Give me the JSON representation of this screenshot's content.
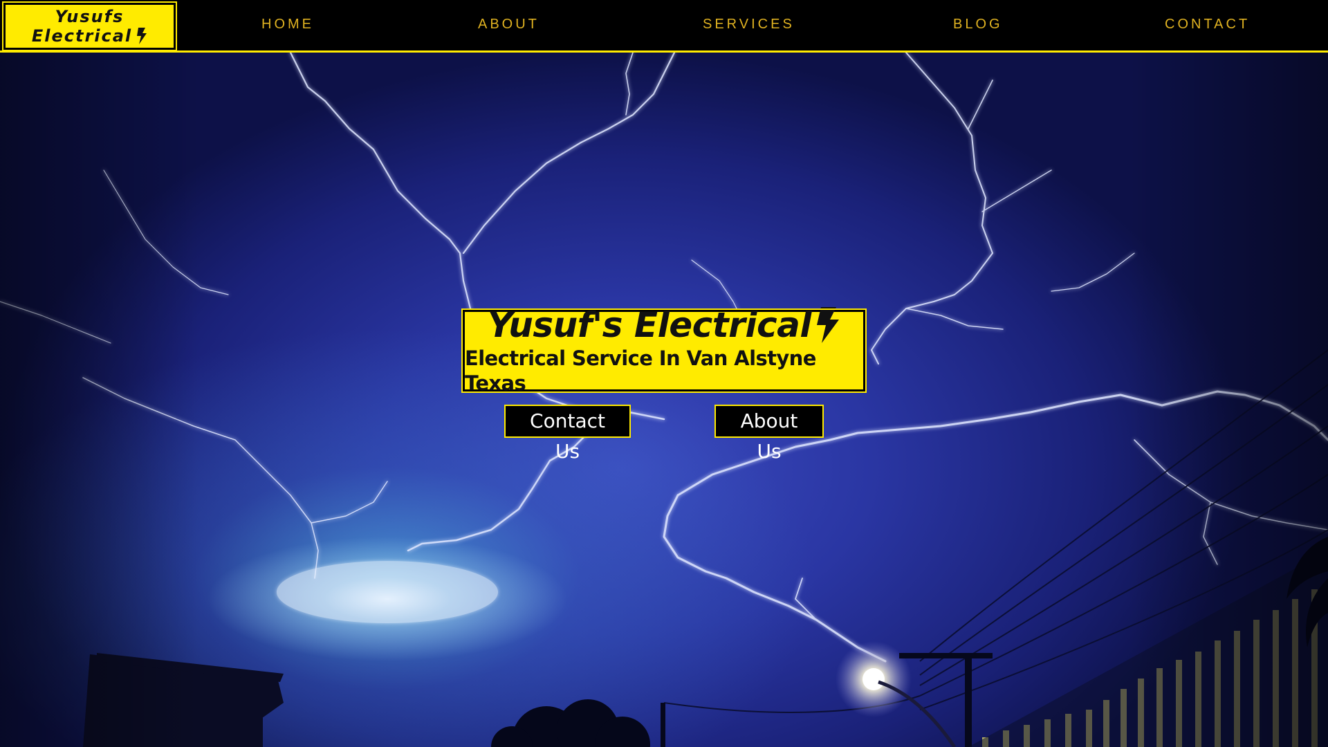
{
  "brand": {
    "line1": "Yusufs",
    "line2": "Electrical",
    "icon": "lightning-bolt-icon",
    "color": "#ffeb00"
  },
  "nav": {
    "items": [
      {
        "label": "HOME"
      },
      {
        "label": "ABOUT"
      },
      {
        "label": "SERVICES"
      },
      {
        "label": "BLOG"
      },
      {
        "label": "CONTACT"
      }
    ],
    "link_color": "#e0b221"
  },
  "hero": {
    "title": "Yusuf's Electrical",
    "subtitle": "Electrical Service In Van Alstyne Texas",
    "title_icon": "lightning-bolt-icon",
    "background": "night-sky-lightning-storm",
    "buttons": {
      "contact": "Contact Us",
      "about": "About Us"
    }
  }
}
